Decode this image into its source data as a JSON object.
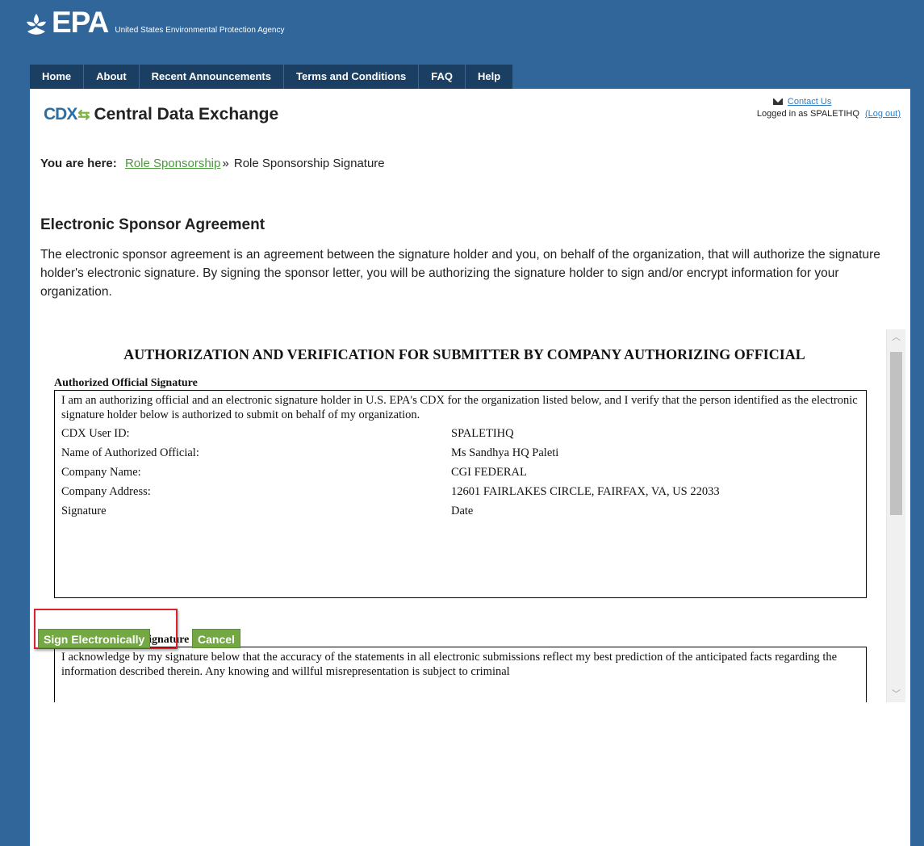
{
  "header": {
    "logo_text": "EPA",
    "agency_name": "United States Environmental Protection Agency"
  },
  "nav": {
    "items": [
      {
        "label": "Home"
      },
      {
        "label": "About"
      },
      {
        "label": "Recent Announcements"
      },
      {
        "label": "Terms and Conditions"
      },
      {
        "label": "FAQ"
      },
      {
        "label": "Help"
      }
    ]
  },
  "cdx": {
    "logo": "CDX",
    "title": "Central Data Exchange"
  },
  "user": {
    "contact_label": "Contact Us",
    "logged_in_prefix": "Logged in as SPALETIHQ",
    "logout_label": "(Log out)"
  },
  "breadcrumb": {
    "prefix": "You are here:",
    "link": "Role Sponsorship",
    "separator": "»",
    "current": "Role Sponsorship Signature"
  },
  "agreement": {
    "heading": "Electronic Sponsor Agreement",
    "intro": "The electronic sponsor agreement is an agreement between the signature holder and you, on behalf of the organization, that will authorize the signature holder's electronic signature. By signing the sponsor letter, you will be authorizing the signature holder to sign and/or encrypt information for your organization.",
    "document_title": "AUTHORIZATION AND VERIFICATION FOR SUBMITTER BY COMPANY AUTHORIZING OFFICIAL",
    "official": {
      "label": "Authorized Official Signature",
      "statement": "I am an authorizing official and an electronic signature holder in U.S. EPA's CDX for the organization listed below, and I verify that the person identified as the electronic signature holder below is authorized to submit on behalf of my organization.",
      "fields": [
        {
          "label": "CDX User ID:",
          "value": "SPALETIHQ"
        },
        {
          "label": "Name of Authorized Official:",
          "value": "Ms Sandhya HQ Paleti"
        },
        {
          "label": "Company Name:",
          "value": "CGI FEDERAL"
        },
        {
          "label": "Company Address:",
          "value": "12601 FAIRLAKES CIRCLE, FAIRFAX, VA, US 22033"
        },
        {
          "label": "Signature",
          "value": "Date"
        }
      ]
    },
    "agent": {
      "label": "Agent/Consultant Signature",
      "statement": "I acknowledge by my signature below that the accuracy of the statements in all electronic submissions reflect my best prediction of the anticipated facts regarding the information described therein. Any knowing and willful misrepresentation is subject to criminal"
    }
  },
  "actions": {
    "sign_label": "Sign Electronically",
    "cancel_label": "Cancel"
  },
  "colors": {
    "background": "#306699",
    "nav": "#1b3f63",
    "button": "#73a843",
    "highlight": "#d9232e",
    "link": "#2e7bc0",
    "breadcrumb_link": "#4a9a3c"
  },
  "icons": {
    "logo": "epa-flower-icon",
    "mail": "mail-icon",
    "scroll_up": "chevron-up-icon",
    "scroll_down": "chevron-down-icon"
  }
}
